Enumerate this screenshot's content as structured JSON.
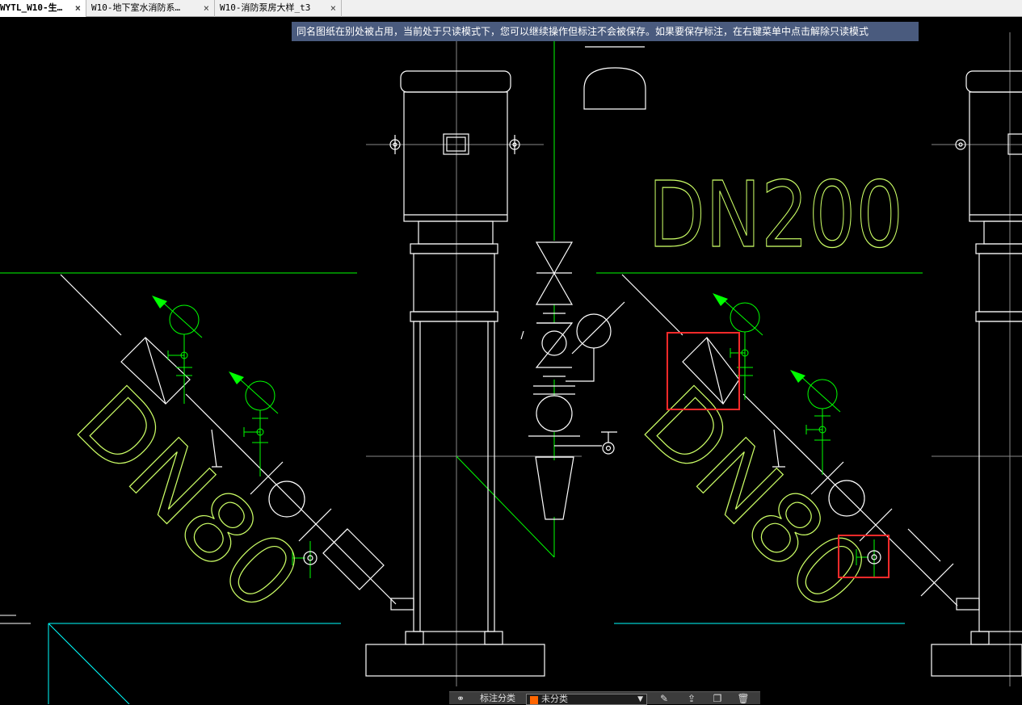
{
  "tabs": [
    {
      "label": "WYTL_W10-生…",
      "active": true
    },
    {
      "label": "W10-地下室水消防系…",
      "active": false
    },
    {
      "label": "W10-消防泵房大样_t3",
      "active": false
    }
  ],
  "tab_close_glyph": "×",
  "notice": "同名图纸在别处被占用，当前处于只读模式下，您可以继续操作但标注不会被保存。如果要保存标注，在右键菜单中点击解除只读模式",
  "drawing": {
    "label_dn200": "DN200",
    "label_dn80_left": "DN80",
    "label_dn80_right": "DN80",
    "colors": {
      "background": "#000000",
      "pipe": "#00ff00",
      "equipment": "#ffffff",
      "annotation": "#ccff66",
      "guide": "#00ffff",
      "highlight": "#ff2a2a"
    }
  },
  "toolbar": {
    "label": "标注分类",
    "selected": "未分类",
    "icons": [
      "group-icon",
      "pen-icon",
      "share-icon",
      "copy-icon",
      "trash-icon"
    ]
  }
}
